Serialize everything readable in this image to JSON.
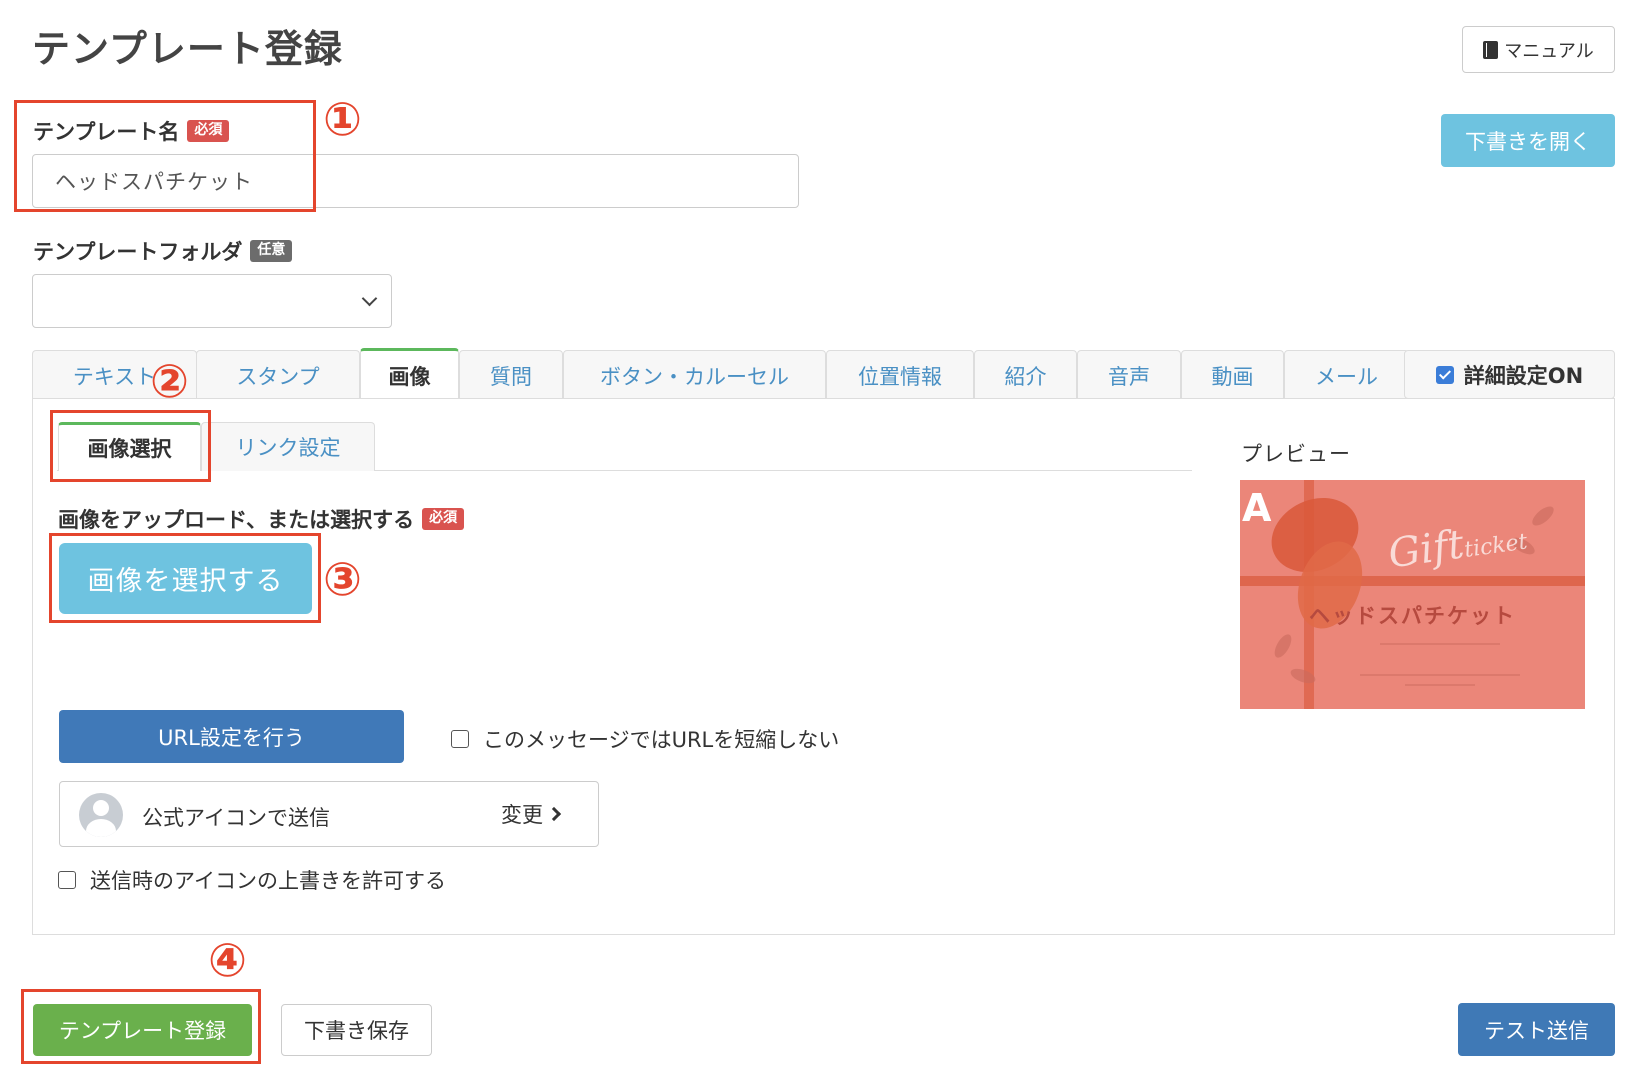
{
  "page": {
    "title": "テンプレート登録"
  },
  "header_actions": {
    "manual_label": "マニュアル",
    "open_draft_label": "下書きを開く"
  },
  "form": {
    "template_name": {
      "label": "テンプレート名",
      "badge": "必須",
      "value": "ヘッドスパチケット"
    },
    "template_folder": {
      "label": "テンプレートフォルダ",
      "badge": "任意",
      "selected": ""
    }
  },
  "tabs": [
    {
      "label": "テキスト",
      "active": false
    },
    {
      "label": "スタンプ",
      "active": false
    },
    {
      "label": "画像",
      "active": true
    },
    {
      "label": "質問",
      "active": false
    },
    {
      "label": "ボタン・カルーセル",
      "active": false
    },
    {
      "label": "位置情報",
      "active": false
    },
    {
      "label": "紹介",
      "active": false
    },
    {
      "label": "音声",
      "active": false
    },
    {
      "label": "動画",
      "active": false
    },
    {
      "label": "メール",
      "active": false
    }
  ],
  "detail_toggle": {
    "label": "詳細設定ON",
    "checked": true
  },
  "subtabs": [
    {
      "label": "画像選択",
      "active": true
    },
    {
      "label": "リンク設定",
      "active": false
    }
  ],
  "image_section": {
    "label": "画像をアップロード、または選択する",
    "badge": "必須",
    "select_button": "画像を選択する",
    "url_button": "URL設定を行う",
    "no_shorten_label": "このメッセージではURLを短縮しない"
  },
  "sender": {
    "label": "公式アイコンで送信",
    "change_label": "変更",
    "override_label": "送信時のアイコンの上書きを許可する"
  },
  "preview": {
    "label": "プレビュー",
    "badge_letter": "A",
    "gift_script": "Gift",
    "gift_small": "ticket",
    "ticket_title": "ヘッドスパチケット"
  },
  "annotations": [
    "①",
    "②",
    "③",
    "④"
  ],
  "footer": {
    "register_label": "テンプレート登録",
    "draft_save_label": "下書き保存",
    "test_send_label": "テスト送信"
  },
  "colors": {
    "annotation_red": "#e4452d",
    "info_blue": "#6ec3e0",
    "primary_blue": "#4079b8",
    "success_green": "#6ab04c",
    "required_red": "#d9534f"
  }
}
